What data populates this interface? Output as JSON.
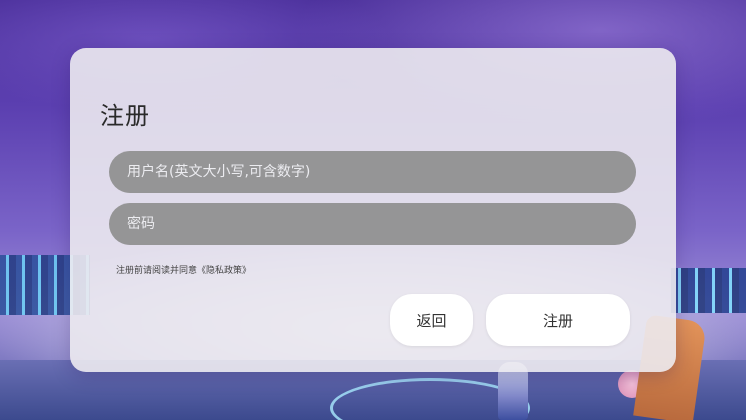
{
  "dialog": {
    "title": "注册",
    "username_placeholder": "用户名(英文大小写,可含数字)",
    "password_placeholder": "密码",
    "agreement_text": "注册前请阅读并同意《隐私政策》",
    "back_label": "返回",
    "register_label": "注册"
  }
}
